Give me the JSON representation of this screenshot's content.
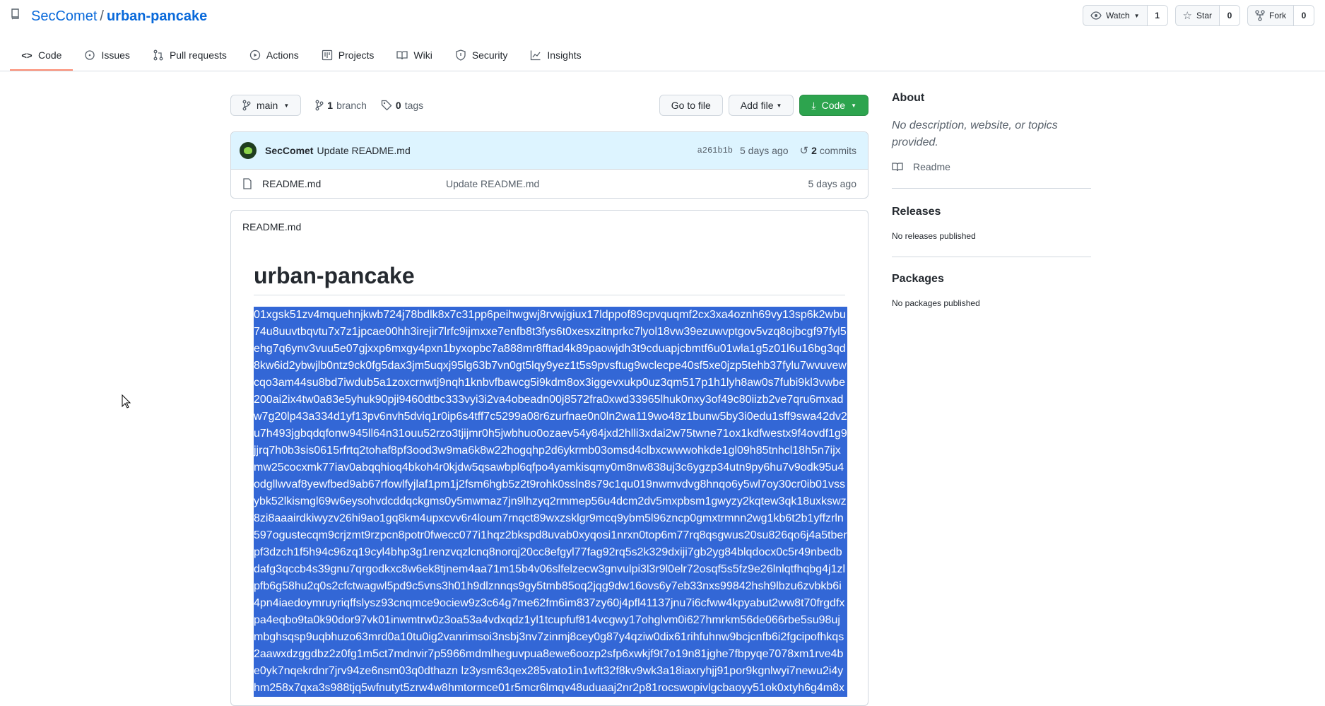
{
  "repo": {
    "owner": "SecComet",
    "slash": "/",
    "name": "urban-pancake"
  },
  "actions": [
    {
      "label": "Watch",
      "count": "1",
      "icon": "eye-icon"
    },
    {
      "label": "Star",
      "count": "0",
      "icon": "star-icon"
    },
    {
      "label": "Fork",
      "count": "0",
      "icon": "fork-icon"
    }
  ],
  "tabs": [
    {
      "label": "Code",
      "icon": "code-icon",
      "active": true
    },
    {
      "label": "Issues",
      "icon": "issue-icon"
    },
    {
      "label": "Pull requests",
      "icon": "pull-request-icon"
    },
    {
      "label": "Actions",
      "icon": "play-icon"
    },
    {
      "label": "Projects",
      "icon": "project-icon"
    },
    {
      "label": "Wiki",
      "icon": "book-icon"
    },
    {
      "label": "Security",
      "icon": "shield-icon"
    },
    {
      "label": "Insights",
      "icon": "graph-icon"
    }
  ],
  "toolbar": {
    "branch": "main",
    "branch_count": "1",
    "branch_label": "branch",
    "tag_count": "0",
    "tag_label": "tags",
    "go_to_file": "Go to file",
    "add_file": "Add file",
    "code": "Code"
  },
  "commit": {
    "author": "SecComet",
    "message": "Update README.md",
    "sha": "a261b1b",
    "time": "5 days ago",
    "commit_count": "2",
    "commit_label": "commits"
  },
  "files": [
    {
      "name": "README.md",
      "message": "Update README.md",
      "time": "5 days ago"
    }
  ],
  "readme": {
    "filename": "README.md",
    "heading": "urban-pancake",
    "text": "01xgsk51zv4mquehnjkwb724j78bdlk8x7c31pp6peihwgwj8rvwjgiux17ldppof89cpvquqmf2cx3xa4oznh69vy13sp6k2wbu74u8uuvtbqvtu7x7z1jpcae00hh3irejir7lrfc9ijmxxe7enfb8t3fys6t0xesxzitnprkc7lyol18vw39ezuwvptgov5vzq8ojbcgf97fyl5ehg7q6ynv3vuu5e07gjxxp6mxgy4pxn1byxopbc7a888mr8fftad4k89paowjdh3t9cduapjcbmtf6u01wla1g5z01l6u16bg3qd8kw6id2ybwjlb0ntz9ck0fg5dax3jm5uqxj95lg63b7vn0gt5lqy9yez1t5s9pvsftug9wclecpe40sf5xe0jzp5tehb37fylu7wvuvewcqo3am44su8bd7iwdub5a1zoxcrnwtj9nqh1knbvfbawcg5i9kdm8ox3iggevxukp0uz3qm517p1h1lyh8aw0s7fubi9kl3vwbe200ai2ix4tw0a83e5yhuk90pji9460dtbc333vyi3i2va4obeadn00j8572fra0xwd33965lhuk0nxy3of49c80iizb2ve7qru6mxadw7g20lp43a334d1yf13pv6nvh5dviq1r0ip6s4tff7c5299a08r6zurfnae0n0ln2wa119wo48z1bunw5by3i0edu1sff9swa42dv2u7h493jgbqdqfonw945ll64n31ouu52rzo3tjijmr0h5jwbhuo0ozaev54y84jxd2hlli3xdai2w75twne71ox1kdfwestx9f4ovdf1g9jjrq7h0b3sis0615rfrtq2tohaf8pf3ood3w9ma6k8w22hogqhp2d6ykrmb03omsd4clbxcwwwohkde1gl09h85tnhcl18h5n7ijxmw25cocxmk77iav0abqqhioq4bkoh4r0kjdw5qsawbpl6qfpo4yamkisqmy0m8nw838uj3c6ygzp34utn9py6hu7v9odk95u4odgllwvaf8yewfbed9ab67rfowlfyjlaf1pm1j2fsm6hgb5z2t9rohk0ssln8s79c1qu019nwmvdvg8hnqo6y5wl7oy30cr0ib01vssybk52lkismgl69w6eysohvdcddqckgms0y5mwmaz7jn9lhzyq2rmmep56u4dcm2dv5mxpbsm1gwyzy2kqtew3qk18uxkswz8zi8aaairdkiwyzv26hi9ao1gq8km4upxcvv6r4loum7rnqct89wxzsklgr9mcq9ybm5l96zncp0gmxtrmnn2wg1kb6t2b1yffzrln597ogustecqm9crjzmt9rzpcn8potr0fwecc077i1hqz2bkspd8uvab0xyqosi1nrxn0top6m77rq8qsgwus20su826qo6j4a5tberpf3dzch1f5h94c96zq19cyl4bhp3g1renzvqzlcnq8norqj20cc8efgyl77fag92rq5s2k329dxiji7gb2yg84blqdocx0c5r49nbedbdafg3qccb4s39gnu7qrgodkxc8w6ek8tjnem4aa71m15b4v06slfelzecw3gnvulpi3l3r9l0elr72osqf5s5fz9e26lnlqtfhqbg4j1zlpfb6g58hu2q0s2cfctwagwl5pd9c5vns3h01h9dlznnqs9gy5tmb85oq2jqg9dw16ovs6y7eb33nxs99842hsh9lbzu6zvbkb6i4pn4iaedoymruyriqffslysz93cnqmce9ociew9z3c64g7me62fm6im837zy60j4pfl41137jnu7i6cfww4kpyabut2ww8t70frgdfxpa4eqbo9ta0k90dor97vk01inwmtrw0z3oa53a4vdxqdz1yl1tcupfuf814vcgwy17ohglvm0i627hmrkm56de066rbe5su98ujmbghsqsp9uqbhuzo63mrd0a10tu0ig2vanrimsoi3nsbj3nv7zinmj8cey0g87y4qziw0dix61rihfuhnw9bcjcnfb6i2fgcipofhkqs2aawxdzggdbz2z0fg1m5ct7mdnvir7p5966mdmlheguvpua8ewe6oozp2sfp6xwkjf9t7o19n81jghe7fbpyqe7078xm1rve4be0yk7nqekrdnr7jrv94ze6nsm03q0dthazn lz3ysm63qex285vato1in1wft32f8kv9wk3a18iaxryhjj91por9kgnlwyi7newu2i4yhm258x7qxa3s988tjq5wfnutyt5zrw4w8hmtormce01r5mcr6lmqv48uduaaj2nr2p81rocswopivlgcbaoyy51ok0xtyh6g4m8x"
  },
  "about": {
    "heading": "About",
    "description": "No description, website, or topics provided.",
    "readme_label": "Readme"
  },
  "releases": {
    "heading": "Releases",
    "text": "No releases published"
  },
  "packages": {
    "heading": "Packages",
    "text": "No packages published"
  }
}
